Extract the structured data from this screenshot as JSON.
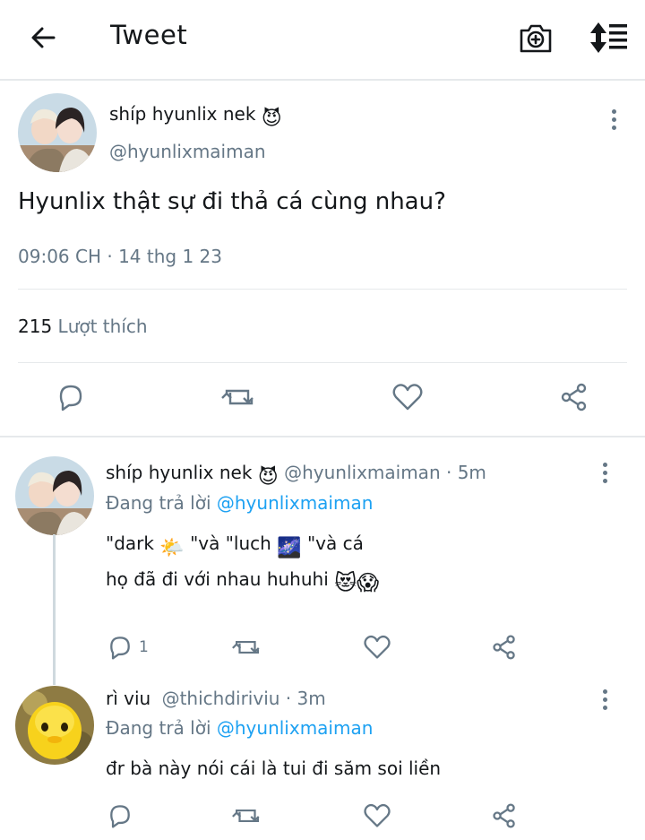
{
  "header": {
    "title": "Tweet",
    "back_icon": "arrow-left-icon",
    "camera_icon": "camera-add-icon",
    "sort_icon": "sort-arrows-icon"
  },
  "tweet": {
    "author_name": "shíp hyunlix nek",
    "author_emoji": "😈",
    "author_handle": "@hyunlixmaiman",
    "text": "Hyunlix thật sự đi thả cá cùng nhau?",
    "timestamp": "09:06 CH · 14 thg 1 23",
    "likes_count": "215",
    "likes_label": "Lượt thích"
  },
  "replies": [
    {
      "name": "shíp hyunlix nek",
      "name_emoji": "😈",
      "handle": "@hyunlixmaiman",
      "time": "· 5m",
      "replying_prefix": "Đang trả lời",
      "replying_to": "@hyunlixmaiman",
      "line1_a": "\"dark ",
      "line1_emoji1": "🌤️",
      "line1_b": " \"và \"luch ",
      "line1_emoji2": "🌌",
      "line1_c": " \"và cá",
      "line2_text": "họ đã đi với nhau huhuhi ",
      "line2_emojis": "😻😱",
      "reply_count": "1"
    },
    {
      "name": "rì viu",
      "handle": "@thichdiriviu",
      "time": "· 3m",
      "replying_prefix": "Đang trả lời",
      "replying_to": "@hyunlixmaiman",
      "body": "đr bà này nói cái là tui đi săm soi liền",
      "reply_count": ""
    }
  ],
  "colors": {
    "accent": "#1da1f2",
    "muted": "#657786",
    "text": "#14171a",
    "divider": "#e6e9eb"
  }
}
